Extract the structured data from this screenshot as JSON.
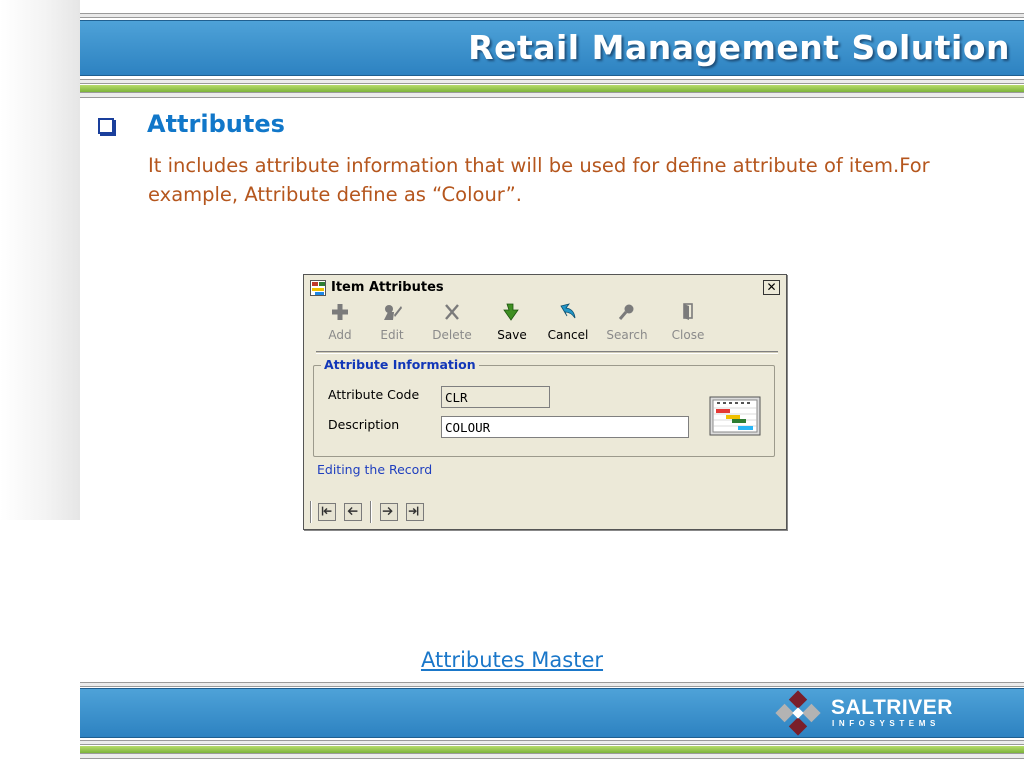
{
  "header": {
    "title": "Retail Management Solution"
  },
  "section": {
    "heading": "Attributes",
    "description": "It includes attribute information that will be used for define attribute of item.For example, Attribute define as “Colour”."
  },
  "dialog": {
    "title": "Item Attributes",
    "close_label": "✕",
    "toolbar": {
      "add": "Add",
      "edit": "Edit",
      "delete": "Delete",
      "save": "Save",
      "cancel": "Cancel",
      "search": "Search",
      "close": "Close"
    },
    "group_title": "Attribute Information",
    "fields": {
      "code_label": "Attribute Code",
      "code_value": "CLR",
      "description_label": "Description",
      "description_value": "COLOUR"
    },
    "status": "Editing the Record",
    "nav_icons": [
      "first-record-icon",
      "previous-record-icon",
      "next-record-icon",
      "last-record-icon"
    ]
  },
  "caption": "Attributes Master",
  "footer": {
    "logo_name": "SALTRIVER",
    "logo_sub": "INFOSYSTEMS"
  },
  "colors": {
    "header_blue": "#2d82c1",
    "accent_green": "#7cb33a",
    "heading_blue": "#1177c9",
    "description_text": "#b5561d",
    "group_title_blue": "#1237b8"
  }
}
